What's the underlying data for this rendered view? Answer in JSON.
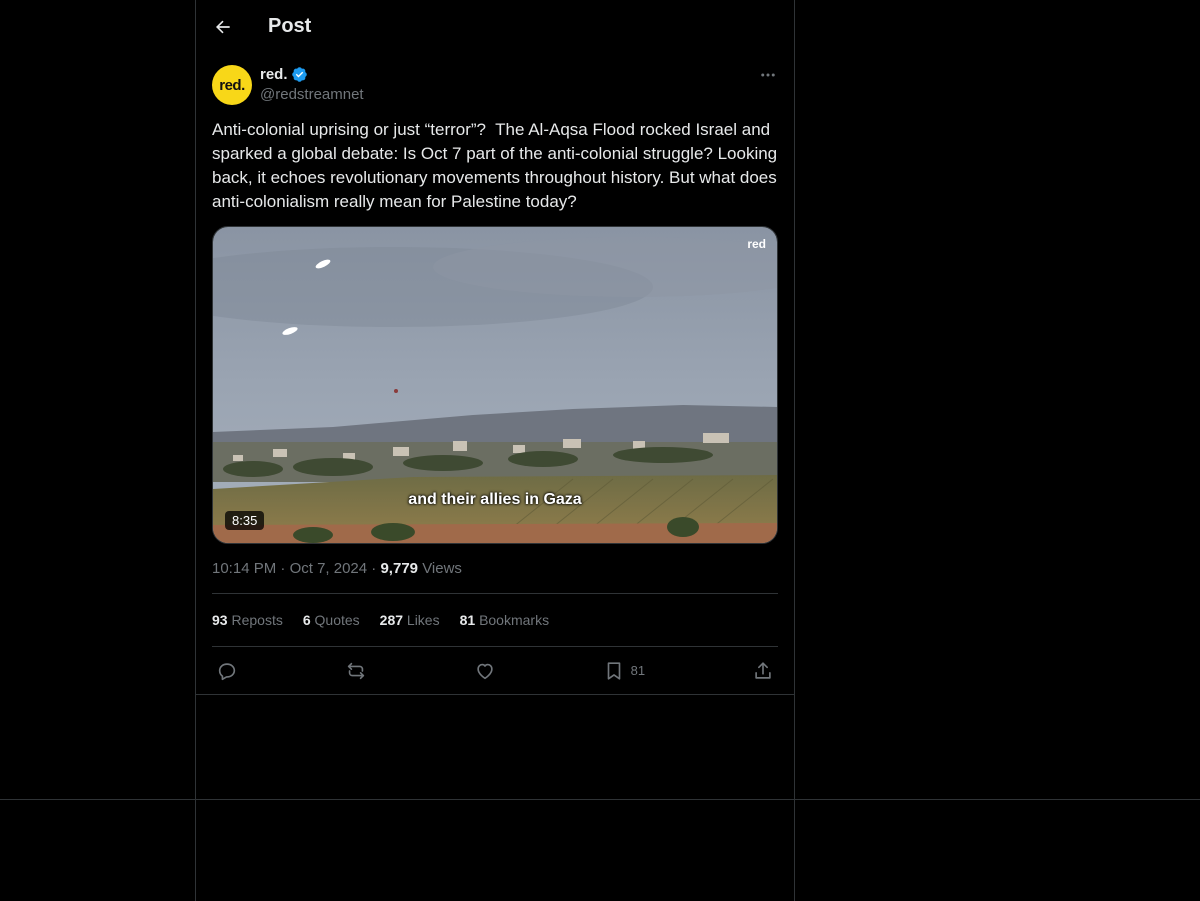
{
  "header": {
    "title": "Post"
  },
  "author": {
    "display_name": "red.",
    "handle": "@redstreamnet",
    "avatar_text": "red."
  },
  "post": {
    "text": "Anti-colonial uprising or just “terror”?  The Al-Aqsa Flood rocked Israel and sparked a global debate: Is Oct 7 part of the anti-colonial struggle? Looking back, it echoes revolutionary movements throughout history. But what does anti-colonialism really mean for Palestine today?"
  },
  "media": {
    "watermark": "red",
    "caption": "and their allies in Gaza",
    "duration": "8:35"
  },
  "meta": {
    "time": "10:14 PM",
    "date": "Oct 7, 2024",
    "separator": "·",
    "views_count": "9,779",
    "views_label": "Views"
  },
  "stats": [
    {
      "count": "93",
      "label": "Reposts"
    },
    {
      "count": "6",
      "label": "Quotes"
    },
    {
      "count": "287",
      "label": "Likes"
    },
    {
      "count": "81",
      "label": "Bookmarks"
    }
  ],
  "actions": {
    "reply": "reply-icon",
    "repost": "repost-icon",
    "like": "heart-icon",
    "bookmark": "bookmark-icon",
    "bookmark_count": "81",
    "share": "share-icon"
  },
  "colors": {
    "background": "#000000",
    "text": "#e7e9ea",
    "muted": "#71767b",
    "border": "#2f3336",
    "verified": "#1d9bf0",
    "avatar": "#f8d718"
  }
}
